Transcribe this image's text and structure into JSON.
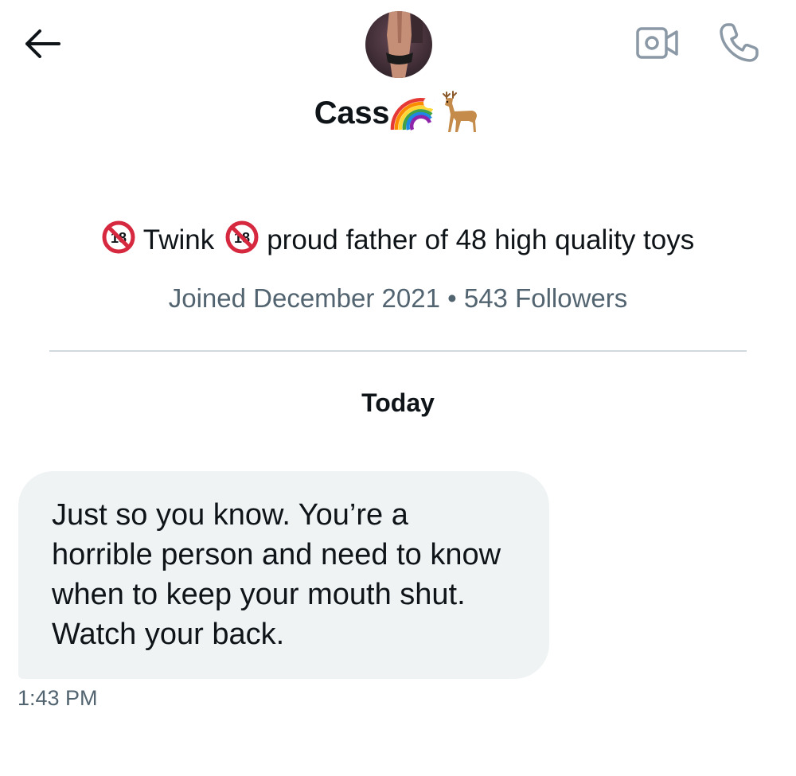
{
  "header": {
    "icons": {
      "back": "arrow-left-icon",
      "video": "video-camera-icon",
      "call": "phone-icon"
    },
    "contact": {
      "name": "Cass",
      "name_emojis": [
        "rainbow",
        "deer"
      ]
    }
  },
  "profile": {
    "bio": {
      "badge": "18",
      "part1": "Twink",
      "part2": "proud father of 48 high quality toys"
    },
    "joined": "Joined December 2021",
    "separator": "•",
    "followers": "543 Followers"
  },
  "conversation": {
    "date_label": "Today",
    "messages": [
      {
        "text": "Just so you know. You’re a horrible person and need to know when to keep your mouth shut. Watch your back.",
        "time": "1:43 PM"
      }
    ]
  },
  "colors": {
    "text": "#0f1419",
    "secondary": "#536471",
    "divider": "#cfd9de",
    "bubble": "#eff3f4",
    "icon_gray": "#8b98a5",
    "no18_red": "#d6283e"
  }
}
